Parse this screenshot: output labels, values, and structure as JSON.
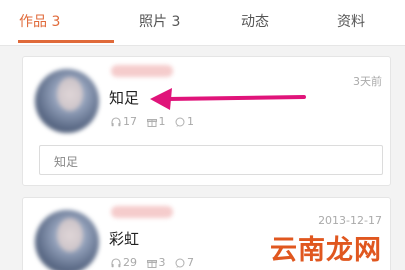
{
  "tabs": [
    {
      "label": "作品 3",
      "active": true
    },
    {
      "label": "照片 3",
      "active": false
    },
    {
      "label": "动态",
      "active": false
    },
    {
      "label": "资料",
      "active": false
    }
  ],
  "accent_color": "#e06a3a",
  "works": [
    {
      "title": "知足",
      "time": "3天前",
      "stats": {
        "listens": "17",
        "gifts": "1",
        "comments": "1"
      },
      "comment": "知足"
    },
    {
      "title": "彩虹",
      "time": "2013-12-17",
      "stats": {
        "listens": "29",
        "gifts": "3",
        "comments": "7"
      }
    }
  ],
  "annotation": {
    "icon": "pink-arrow-icon",
    "color": "#e0147a"
  },
  "watermark": "云南龙网"
}
